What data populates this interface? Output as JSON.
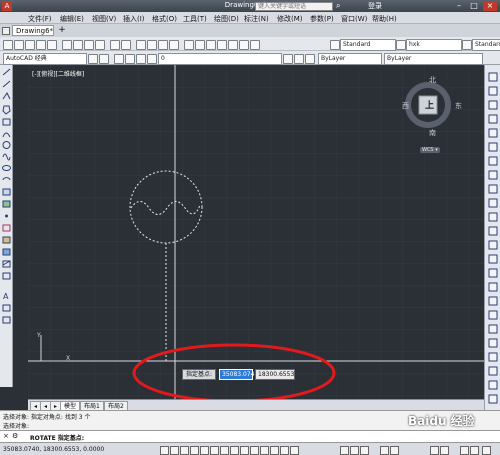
{
  "titlebar": {
    "title": "Drawing6.dwg",
    "search_placeholder": "键入关键字或短语",
    "login_label": "登录",
    "minimize": "–",
    "maximize": "□",
    "close": "×"
  },
  "menubar": {
    "items": [
      "文件(F)",
      "编辑(E)",
      "视图(V)",
      "插入(I)",
      "格式(O)",
      "工具(T)",
      "绘图(D)",
      "标注(N)",
      "修改(M)",
      "参数(P)",
      "窗口(W)",
      "帮助(H)"
    ]
  },
  "tabs": {
    "document_tab": "Drawing6*"
  },
  "toolbar": {
    "text_style": "Standard",
    "dim_style": "hxk",
    "workspace": "AutoCAD 经典",
    "layer": "0",
    "color": "ByLayer",
    "linetype": "ByLayer",
    "table_style": "Standard"
  },
  "viewport": {
    "label": "[-][俯视][二维线框]"
  },
  "viewcube": {
    "north": "北",
    "south": "南",
    "east": "东",
    "west": "西",
    "top_face": "上",
    "wcs": "WCS ▾"
  },
  "dynamic_input": {
    "prompt": "指定基点:",
    "x_value": "35083.074",
    "y_value": "18300.6553"
  },
  "layout_tabs": [
    "模型",
    "布局1",
    "布局2"
  ],
  "command_history": [
    "选择对象: 指定对角点: 找到 3 个",
    "选择对象:"
  ],
  "command_line": {
    "text": "ROTATE 指定基点:"
  },
  "status": {
    "coordinates": "35083.0740, 18300.6553, 0.0000"
  },
  "watermark": "Baidu 经验"
}
